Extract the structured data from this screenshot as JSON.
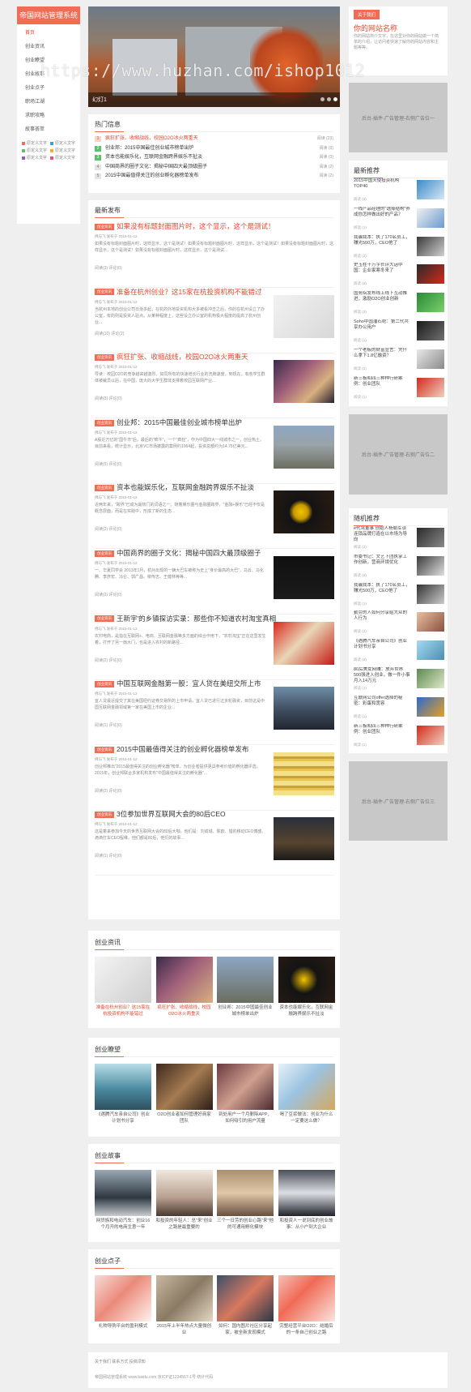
{
  "leftnav": {
    "brand": "帝国网站管理系统",
    "items": [
      "首页",
      "创业资讯",
      "创业瞭望",
      "创业故事",
      "创业点子",
      "职场江湖",
      "求职攻略",
      "故事荟萃"
    ],
    "tags": [
      "原定义文字",
      "原定义文字",
      "原定义文字",
      "原定义文字",
      "原定义文字",
      "原定义文字"
    ],
    "tag_colors": [
      "#f26b54",
      "#59c06c",
      "#3aa0d8",
      "#f0ad33",
      "#9b59b6",
      "#e84c8b"
    ]
  },
  "slider": {
    "caption": "幻灯1"
  },
  "watermark": "https://www.huzhan.com/ishop1012",
  "hot": {
    "title": "热门信息",
    "items": [
      {
        "n": "1",
        "text": "疯狂扩张、收缩战线，校园O2O冰火两重天",
        "meta": "阅读 (23)"
      },
      {
        "n": "2",
        "text": "创业邦：2015中国最佳创业城市榜单出炉",
        "meta": "阅读 (9)"
      },
      {
        "n": "3",
        "text": "资本也能娱乐化，互联网金融跨界娱乐不扯淡",
        "meta": "阅读 (3)"
      },
      {
        "n": "4",
        "text": "中国商界的圈子文化：揭秘中国四大最顶级圈子",
        "meta": "阅读 (2)"
      },
      {
        "n": "5",
        "text": "2015中国最值得关注的创业孵化器榜单发布",
        "meta": "阅读 (2)"
      }
    ]
  },
  "latest": {
    "title": "最新发布",
    "tag": "创业资讯",
    "articles": [
      {
        "title": "如果没有标题封面图片时，这个显示，这个是测试！",
        "meta": "佛与飞 发布于 2015-01-12",
        "desc": "如果没有标题封面图片时，这样显示，这个是测试！如果没有标题封面图片时，这样显示，这个是测试！如果没有标题封面图片时，这样显示，这个是测试！如果没有标题封面图片时，这样显示，这个是测试...",
        "foot": "阅读(3)    评论(0)"
      },
      {
        "title": "准备在杭州创业？这15家在杭投资机构不能错过",
        "meta": "佛与飞 发布于 2015-01-12",
        "desc": "当杭州本地的创业公司日渐多起，在杭的外地投资机构大多被看冲击之后，你的在杭州设立了办公室，有的则是投资人驻点。从某种程度上，这些设立办公室的机构极大程度的提高了杭州创业...",
        "foot": "阅读(10)    评论(2)"
      },
      {
        "title": "疯狂扩张、收缩战线，校园O2O冰火两重天",
        "meta": "佛与飞 发布于 2015-01-12",
        "desc": "导读：校园O2O的竞争越来越激烈，如同所有的快速增长行业的洗牌速度，到现在，有些学生群体被裁员以后，在中国，庞大的大学生群体支撑着校园互联网产业...",
        "foot": "阅读(3)    评论(0)"
      },
      {
        "title": "创业邦：2015中国最佳创业城市榜单出炉",
        "meta": "佛与飞 发布于 2015-01-12",
        "desc": "A股近万亿的\"国牛市\"后，最后的\"疯牛\"，一个\"疯狂\"，作为中国四大一线城市之一，创业热土。目前来看，统计显示，北京VC市场披露的案例约1064起，投资总额约为14.75亿美元...",
        "foot": "阅读(5)    评论(0)"
      },
      {
        "title": "资本也能娱乐化，互联网金融跨界娱乐不扯淡",
        "meta": "佛与飞 发布于 2015-01-12",
        "desc": "近两年来，\"跨界\"已成为最热门的词语之一。随着娱乐圈与金融圈跨界，\"金融+娱乐\"已经不仅是概念层面，而是在实践中，形成了新的生态...",
        "foot": "阅读(2)    评论(0)"
      },
      {
        "title": "中国商界的圈子文化：揭秘中国四大最顶级圈子",
        "meta": "佛与飞 发布于 2015-01-12",
        "desc": "一、华夏同学会 2013年1月，杭州出现的一辆大巴车被称为史上\"身价最高的大巴\"，马云、马化腾、李彦宏、冯仑、郭广昌、柳传志、王健林等等...",
        "foot": "阅读(2)    评论(0)"
      },
      {
        "title": "王新宇'的乡镇探访实录：那些你不知道农村淘宝真相",
        "meta": "佛与飞 发布于 2015-01-12",
        "desc": "农村电商，是指在互联网+、电商、互联网金融等多方面的综合作用下，\"农村淘宝\"正在这里发生着，打开了另一扇大门，也是进入农村的新路径...",
        "foot": "阅读(2)    评论(0)"
      },
      {
        "title": "中国互联网金融第一股：宜人贷在美纽交所上市",
        "meta": "佛与飞 发布于 2015-01-12",
        "desc": "宜人贷最近提交了其在美国纽约证券交易所的上市申请，宜人贷已进行过多轮融资，目前这是中国互联网金融领域第一家在美国上市的企业...",
        "foot": "阅读(1)    评论(0)"
      },
      {
        "title": "2015中国最值得关注的创业孵化器榜单发布",
        "meta": "佛与飞 发布于 2015-01-12",
        "desc": "创业邦推出\"2015最值得关注的创业孵化器\"榜单，为创业者提供更具参考价值的孵化器评选，2015年，创业邦联合多家机构发布\"中国最值得关注的孵化器\"...",
        "foot": "阅读(2)    评论(0)"
      },
      {
        "title": "3位参加世界互联网大会的80后CEO",
        "meta": "佛与飞 发布于 2015-01-12",
        "desc": "这是乘来参加今天的世界互联网大会的80后大咖，他们是：刘成城、陈欧、猎豹移动CEO傅盛、滴滴打车CEO程维。他们都是80后，他们的故事...",
        "foot": "阅读(1)    评论(0)"
      }
    ]
  },
  "gallery1": {
    "title": "创业资讯",
    "items": [
      "准备在杭州创业？这15家在杭投资机构不能错过",
      "疯狂扩张、收缩战线，校园O2O冰火两重天",
      "创业邦：2015中国最佳创业城市榜单出炉",
      "资本也能娱乐化，互联网金融跨界娱乐不扯淡"
    ]
  },
  "gallery2": {
    "title": "创业瞭望",
    "items": [
      "《遇腾汽车亲自公司》创业计划书分享",
      "O2O创业者如何管理好商家团队",
      "到处用户一个月删除APP，如何吸引的用户流量",
      "喝了豆浆做法：创业为什么一定要这么做？"
    ]
  },
  "gallery3": {
    "title": "创业故事",
    "items": [
      "网贷族和电动汽车：创业16个月开的电商生意一年",
      "和投资的年轻人：总\"来\"创业之路是最重要的",
      "三个一日劳的创业心路\"来\"他的可通用孵化模块",
      "和投资人一说到底的创业故事：从小户到大企业"
    ]
  },
  "gallery4": {
    "title": "创业点子",
    "items": [
      "礼物导购平台的盈利模式",
      "2015年上半年热点大量微创业",
      "如何：国内图片社区分享起家，被全新发现模式",
      "完整经营平台O2O：结婚后的一条自己创业之路"
    ]
  },
  "right": {
    "top_btn": "关于我们",
    "site_name": "你的网站名称",
    "site_desc": "你的网站简介文字，在这里对你的网站做一个简单的介绍，让访问者快速了解你的网站内容和主题等等。",
    "ad1": "后台-插件-广告管理-右侧广告位一",
    "ad2": "后台-插件-广告管理-右侧广告位二",
    "ad3": "后台-插件-广告管理-右侧广告位三",
    "rec_title": "最新推荐",
    "rand_title": "随机推荐",
    "rec": [
      {
        "text": "2015中国天使投资机构TOP40",
        "date": "阅读 (3)"
      },
      {
        "text": "一线产品经理的\"选择结构\"养成你怎样做出好的产品？",
        "date": "阅读 (1)"
      },
      {
        "text": "我骗我本：执了170名员工，赚光500万，CEO他了",
        "date": "阅读 (2)"
      },
      {
        "text": "史玉柱十万字长评大话中国：企业家寒冬来了",
        "date": "阅读 (2)"
      },
      {
        "text": "国务院发布线上线下互动推进，激励O2O创业创新",
        "date": "阅读 (3)"
      },
      {
        "text": "Soho中国潘石屹：第二代共享办公用户",
        "date": "阅读 (1)"
      },
      {
        "text": "一个老板的财富宣言：凭什么拿下1.8亿融资？",
        "date": "阅读 (2)"
      },
      {
        "text": "新三板和四三种种行研案例：创业团队",
        "date": "阅读 (1)"
      }
    ],
    "rand": [
      {
        "text": "e代驾董事 创始人杨朝军谈连锁品牌打造在以市场为导向",
        "date": "阅读 (2)"
      },
      {
        "text": "市委书记：文艺下团执掌工作创新，营商环境优化",
        "date": "阅读 (2)"
      },
      {
        "text": "我骗我本：执了170名员工，赚光500万，CEO他了",
        "date": "阅读 (1)"
      },
      {
        "text": "勤劳的人如何分享给大众的人行为",
        "date": "阅读 (2)"
      },
      {
        "text": "《遇腾汽车亲自公司》创业计划书分享",
        "date": "阅读 (2)"
      },
      {
        "text": "80后美女网赚：放弃世界500强进入创业，做一件小事月入14万元",
        "date": "阅读 (1)"
      },
      {
        "text": "互联网公司offer选择的秘密：彩蛋和宽容",
        "date": "阅读 (1)"
      },
      {
        "text": "新三板和四三种种行研案例：创业团队",
        "date": "阅读 (1)"
      }
    ]
  },
  "footer": {
    "links": "关于我们    联系方式    投稿须知",
    "copyright": "帝国网站管理系统 www.baidu.com  京ICP证1234567-1号  统计代码"
  }
}
